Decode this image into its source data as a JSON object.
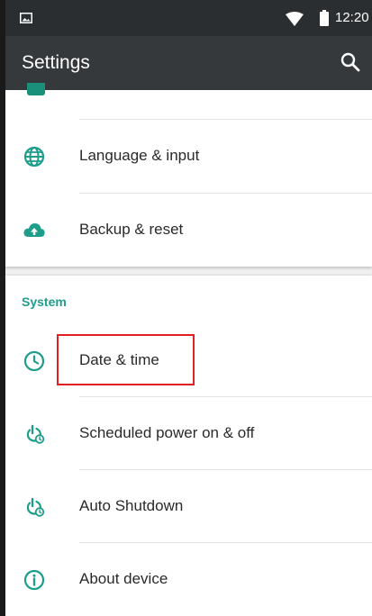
{
  "status_bar": {
    "time": "12:20",
    "icons": [
      "image-notification-icon",
      "wifi-icon",
      "battery-icon"
    ]
  },
  "toolbar": {
    "title": "Settings",
    "search_icon": "search-icon"
  },
  "sections": [
    {
      "items": [
        {
          "label": "Language & input",
          "icon": "globe-icon"
        },
        {
          "label": "Backup & reset",
          "icon": "cloud-upload-icon"
        }
      ]
    },
    {
      "header": "System",
      "items": [
        {
          "label": "Date & time",
          "icon": "clock-icon"
        },
        {
          "label": "Scheduled power on & off",
          "icon": "power-clock-icon"
        },
        {
          "label": "Auto Shutdown",
          "icon": "power-clock-icon"
        },
        {
          "label": "About device",
          "icon": "info-icon"
        }
      ]
    }
  ],
  "colors": {
    "accent": "#1e9d8b",
    "status_bar_bg": "#2b2e30",
    "toolbar_bg": "#35393b",
    "highlight": "#e02020"
  }
}
